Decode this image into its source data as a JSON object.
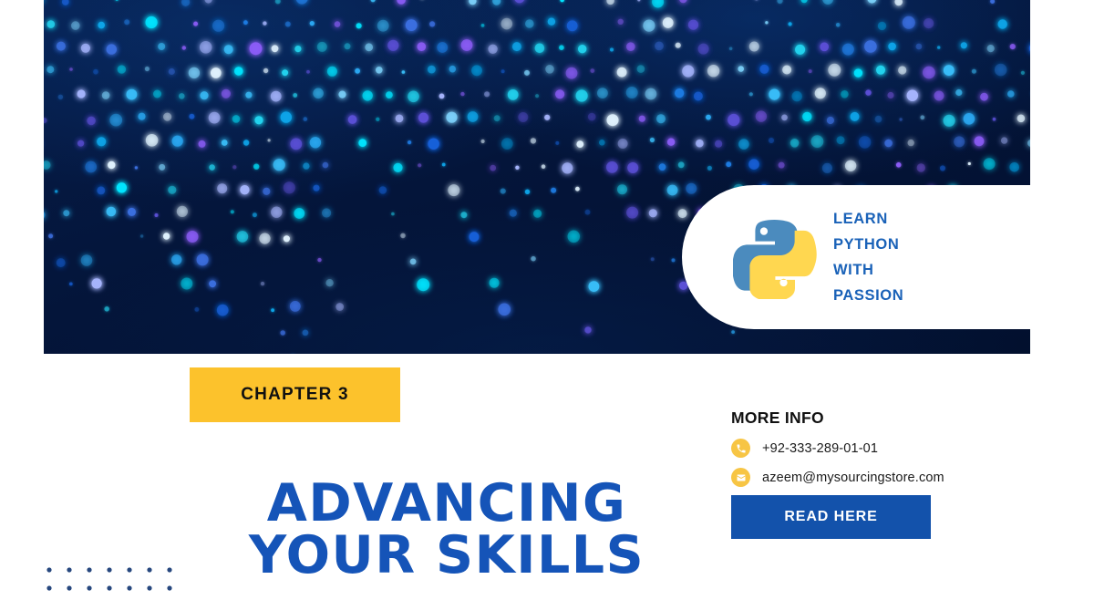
{
  "colors": {
    "hero_background": "#04153a",
    "title_blue": "#1554b8",
    "badge_text_blue": "#1a62b8",
    "chapter_yellow": "#fcc22c",
    "cta_blue": "#1352ab",
    "icon_yellow": "#f7c544",
    "python_blue": "#4b8bbe",
    "python_yellow": "#ffd750",
    "dot_grid_navy": "#26477e"
  },
  "hero": {
    "alt": "dark navy background with diagonal streams of glowing blue and cyan dots"
  },
  "badge": {
    "logo_icon": "python-logo-icon",
    "lines": [
      "LEARN",
      "PYTHON",
      "WITH",
      "PASSION"
    ]
  },
  "chapter": {
    "label": "CHAPTER 3"
  },
  "title": {
    "line1": "ADVANCING",
    "line2": "YOUR SKILLS"
  },
  "info": {
    "heading": "MORE INFO",
    "rows": [
      {
        "icon": "phone-icon",
        "text": "+92-333-289-01-01"
      },
      {
        "icon": "envelope-icon",
        "text": "azeem@mysourcingstore.com"
      }
    ]
  },
  "cta": {
    "label": "READ HERE"
  },
  "dot_grid": {
    "columns": 7,
    "rows": 2
  }
}
